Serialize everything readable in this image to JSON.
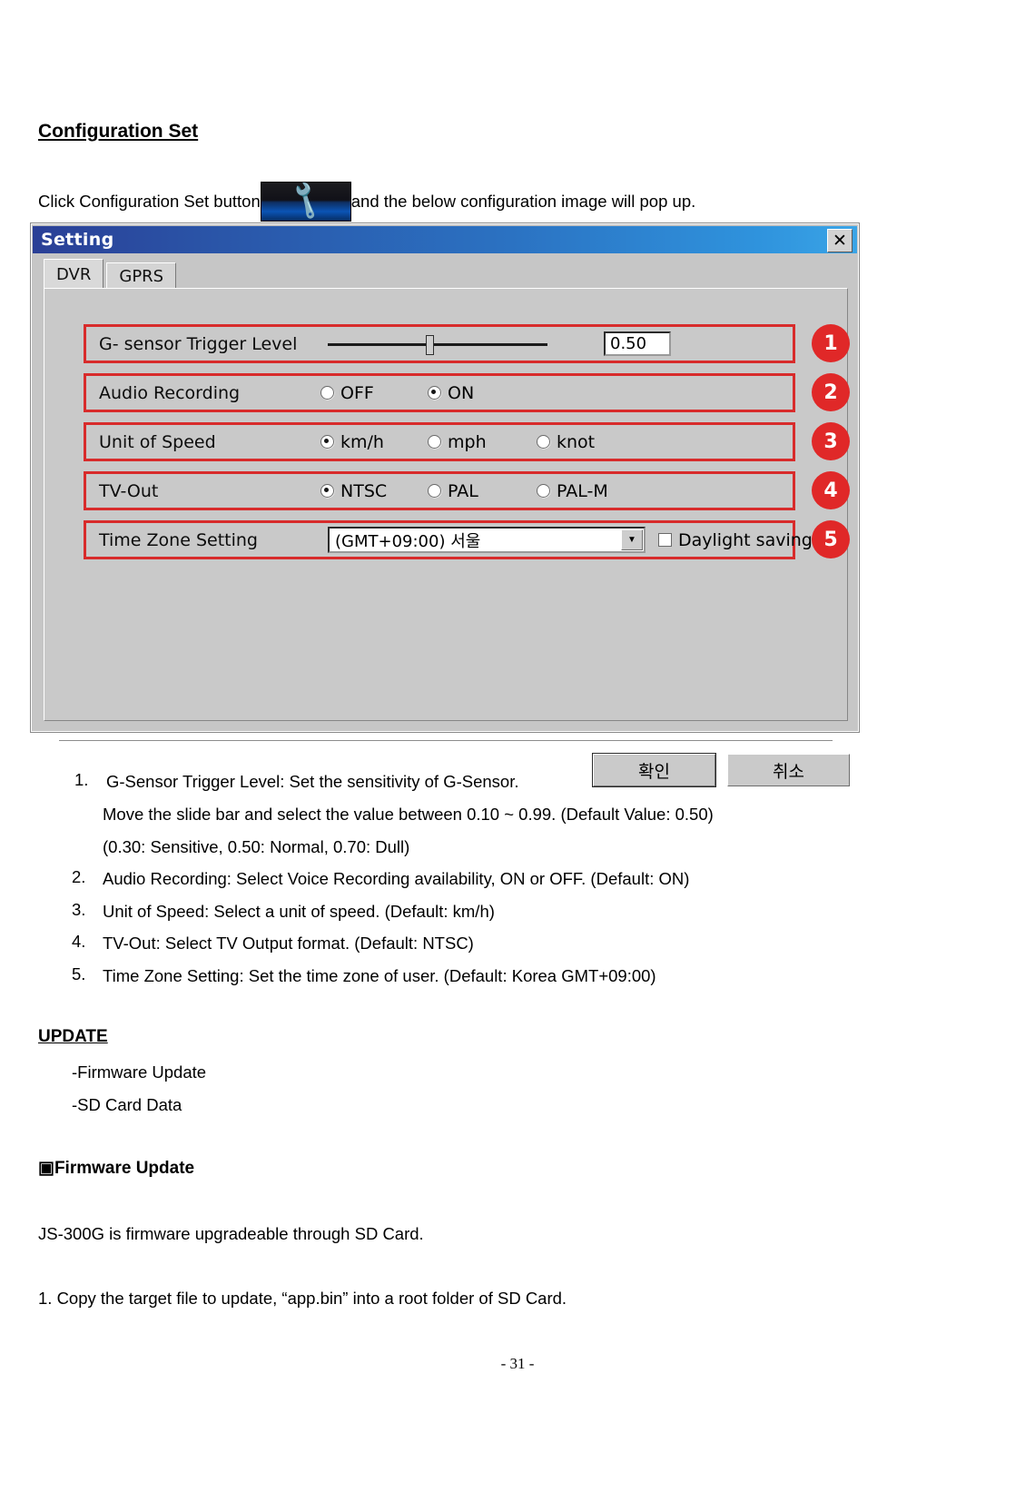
{
  "document": {
    "heading": "Configuration Set",
    "intro_before": "Click Configuration Set button",
    "intro_after": "and the below configuration image will pop up.",
    "wrench_icon": "wrench-icon",
    "page_number": "- 31 -"
  },
  "dialog": {
    "title": "Setting",
    "close_label": "✕",
    "tabs": [
      {
        "label": "DVR",
        "active": true
      },
      {
        "label": "GPRS",
        "active": false
      }
    ],
    "rows": [
      {
        "badge": "1",
        "label": "G- sensor Trigger Level",
        "control": "slider",
        "value": "0.50",
        "slider_min": "0.10",
        "slider_max": "0.99",
        "slider_position_pct": 45
      },
      {
        "badge": "2",
        "label": "Audio Recording",
        "control": "radio",
        "options": [
          {
            "label": "OFF",
            "checked": false
          },
          {
            "label": "ON",
            "checked": true
          }
        ]
      },
      {
        "badge": "3",
        "label": "Unit of Speed",
        "control": "radio",
        "options": [
          {
            "label": "km/h",
            "checked": true
          },
          {
            "label": "mph",
            "checked": false
          },
          {
            "label": "knot",
            "checked": false
          }
        ]
      },
      {
        "badge": "4",
        "label": "TV-Out",
        "control": "radio",
        "options": [
          {
            "label": "NTSC",
            "checked": true
          },
          {
            "label": "PAL",
            "checked": false
          },
          {
            "label": "PAL-M",
            "checked": false
          }
        ]
      },
      {
        "badge": "5",
        "label": "Time Zone Setting",
        "control": "combo",
        "combo_value": "(GMT+09:00) 서울",
        "combo_arrow": "▼",
        "checkbox_label": "Daylight saving",
        "checkbox_checked": false
      }
    ],
    "buttons": {
      "ok": "확인",
      "cancel": "취소"
    }
  },
  "notes": {
    "items": [
      {
        "num": "1.",
        "lines": [
          "G-Sensor Trigger Level: Set the sensitivity of G-Sensor.",
          "Move the slide bar and select the value between 0.10 ~ 0.99. (Default Value: 0.50)",
          "(0.30: Sensitive, 0.50: Normal, 0.70: Dull)"
        ]
      },
      {
        "num": "2.",
        "lines": [
          "Audio Recording:    Select Voice Recording availability, ON or OFF.    (Default: ON)"
        ]
      },
      {
        "num": "3.",
        "lines": [
          "Unit of Speed: Select a unit of speed. (Default: km/h)"
        ]
      },
      {
        "num": "4.",
        "lines": [
          "TV-Out: Select TV Output format. (Default: NTSC)"
        ]
      },
      {
        "num": "5.",
        "lines": [
          "Time Zone Setting: Set the time zone of user. (Default: Korea GMT+09:00)"
        ]
      }
    ]
  },
  "update_section": {
    "heading": "UPDATE",
    "bullets": [
      "-Firmware Update",
      "-SD Card Data"
    ],
    "subheading": "▣Firmware Update",
    "body_line": "JS-300G is firmware upgradeable through SD Card.",
    "step_1": "1. Copy the target file to update, “app.bin” into a root folder of SD Card."
  },
  "colors": {
    "highlight_red": "#d82b2b",
    "badge_red": "#e02828",
    "title_blue": "#2a55a8",
    "dialog_gray": "#c9c9c9"
  }
}
